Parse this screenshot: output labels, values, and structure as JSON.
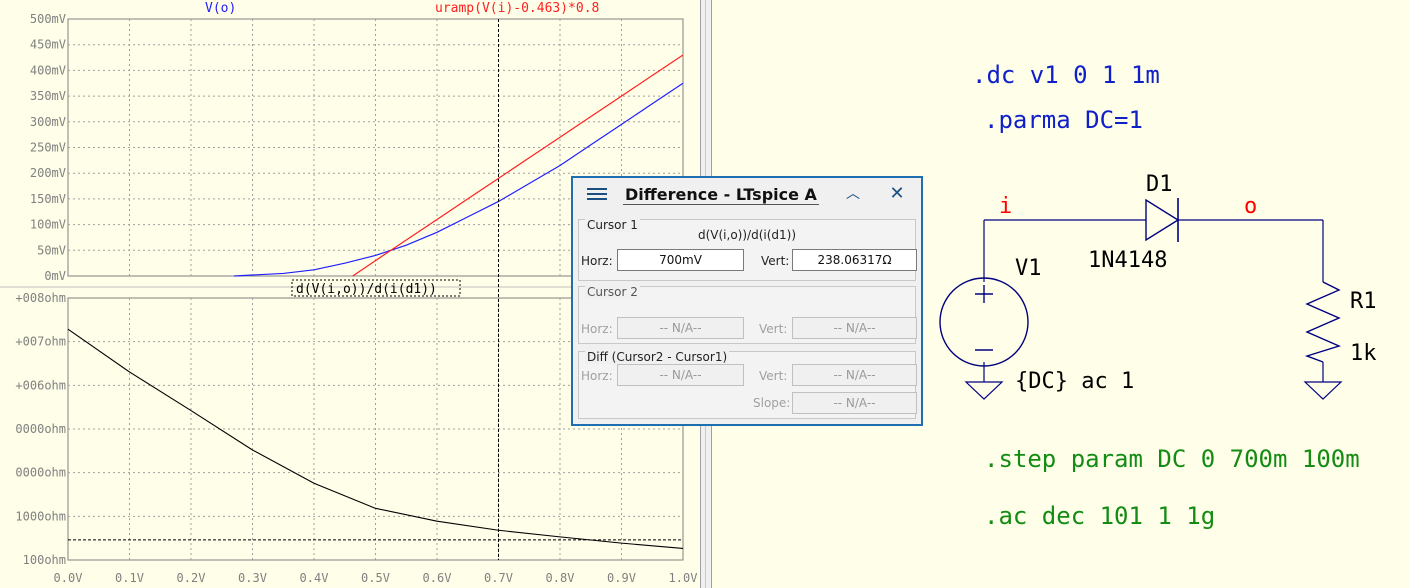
{
  "plot": {
    "top_pane": {
      "trace_labels": [
        {
          "text": "V(o)",
          "color": "#2020ff"
        },
        {
          "text": "uramp(V(i)-0.463)*0.8",
          "color": "#ff2020"
        }
      ],
      "y_ticks": [
        "500mV",
        "450mV",
        "400mV",
        "350mV",
        "300mV",
        "250mV",
        "200mV",
        "150mV",
        "100mV",
        "50mV",
        "0mV"
      ]
    },
    "bottom_pane": {
      "trace_label": "d(V(i,o))/d(i(d1))",
      "y_ticks": [
        "+008ohm",
        "+007ohm",
        "+006ohm",
        "0000ohm",
        "0000ohm",
        "1000ohm",
        "100ohm"
      ]
    },
    "x_ticks": [
      "0.0V",
      "0.1V",
      "0.2V",
      "0.3V",
      "0.4V",
      "0.5V",
      "0.6V",
      "0.7V",
      "0.8V",
      "0.9V",
      "1.0V"
    ],
    "chart_data": [
      {
        "type": "line",
        "x_unit": "V",
        "xlim": [
          0,
          1.0
        ],
        "ylim": [
          0,
          0.5
        ],
        "y_unit": "V",
        "series": [
          {
            "name": "V(o)",
            "color": "#2020ff",
            "x": [
              0.27,
              0.35,
              0.4,
              0.45,
              0.5,
              0.55,
              0.6,
              0.65,
              0.7,
              0.75,
              0.8,
              0.85,
              0.9,
              0.95,
              1.0
            ],
            "y": [
              0.0,
              0.005,
              0.012,
              0.025,
              0.04,
              0.06,
              0.085,
              0.115,
              0.145,
              0.18,
              0.215,
              0.255,
              0.295,
              0.335,
              0.375
            ]
          },
          {
            "name": "uramp(V(i)-0.463)*0.8",
            "color": "#ff2020",
            "x": [
              0.463,
              0.5,
              0.55,
              0.6,
              0.65,
              0.7,
              0.75,
              0.8,
              0.85,
              0.9,
              0.95,
              1.0
            ],
            "y": [
              0.0,
              0.03,
              0.07,
              0.11,
              0.15,
              0.19,
              0.23,
              0.27,
              0.31,
              0.35,
              0.39,
              0.43
            ]
          }
        ]
      },
      {
        "type": "line",
        "x_unit": "V",
        "xlim": [
          0,
          1.0
        ],
        "y_scale": "log",
        "series": [
          {
            "name": "d(V(i,o))/d(i(d1))",
            "color": "#000000",
            "x": [
              0.0,
              0.1,
              0.2,
              0.3,
              0.4,
              0.5,
              0.6,
              0.7,
              0.8,
              0.9,
              1.0
            ],
            "y": [
              20000000,
              2000000,
              250000,
              30000,
              5000,
              1300,
              650,
              400,
              280,
              200,
              150
            ]
          }
        ],
        "cursor_line_y": 238.06317,
        "cursor_x": 0.7
      }
    ]
  },
  "schematic": {
    "directives_blue": [
      ".dc v1 0 1 1m",
      ".parma DC=1"
    ],
    "directives_green": [
      ".step param DC 0 700m 100m",
      ".ac dec 101 1 1g"
    ],
    "nets": {
      "input": "i",
      "output": "o"
    },
    "diode": {
      "ref": "D1",
      "model": "1N4148"
    },
    "source": {
      "ref": "V1",
      "value": "{DC} ac 1"
    },
    "resistor": {
      "ref": "R1",
      "value": "1k"
    },
    "colors": {
      "blue": "#1020c8",
      "green": "#148c14",
      "red": "#ff0000",
      "wire": "#000080"
    }
  },
  "cursor_dialog": {
    "title": "Difference - LTspice A",
    "cursor1": {
      "label": "Cursor 1",
      "expression": "d(V(i,o))/d(i(d1))",
      "horz_label": "Horz:",
      "horz": "700mV",
      "vert_label": "Vert:",
      "vert": "238.06317Ω"
    },
    "cursor2": {
      "label": "Cursor 2",
      "horz_label": "Horz:",
      "horz": "-- N/A--",
      "vert_label": "Vert:",
      "vert": "-- N/A--"
    },
    "diff": {
      "label": "Diff (Cursor2 - Cursor1)",
      "horz_label": "Horz:",
      "horz": "-- N/A--",
      "vert_label": "Vert:",
      "vert": "-- N/A--",
      "slope_label": "Slope:",
      "slope": "-- N/A--"
    }
  }
}
